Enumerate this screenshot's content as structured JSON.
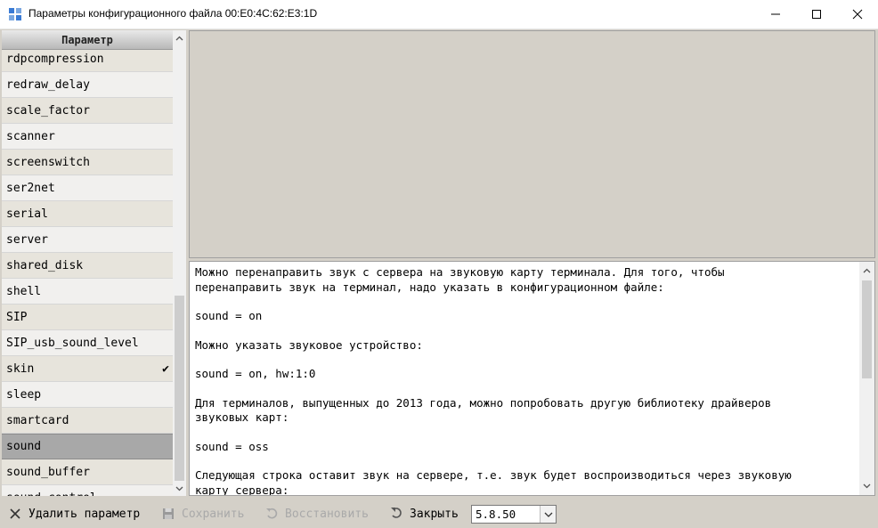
{
  "window": {
    "title": "Параметры конфигурационного файла 00:E0:4C:62:E3:1D"
  },
  "params": {
    "header": "Параметр",
    "items": [
      {
        "label": "rdpcompression",
        "checked": false,
        "selected": false
      },
      {
        "label": "redraw_delay",
        "checked": false,
        "selected": false
      },
      {
        "label": "scale_factor",
        "checked": false,
        "selected": false
      },
      {
        "label": "scanner",
        "checked": false,
        "selected": false
      },
      {
        "label": "screenswitch",
        "checked": false,
        "selected": false
      },
      {
        "label": "ser2net",
        "checked": false,
        "selected": false
      },
      {
        "label": "serial",
        "checked": false,
        "selected": false
      },
      {
        "label": "server",
        "checked": false,
        "selected": false
      },
      {
        "label": "shared_disk",
        "checked": false,
        "selected": false
      },
      {
        "label": "shell",
        "checked": false,
        "selected": false
      },
      {
        "label": "SIP",
        "checked": false,
        "selected": false
      },
      {
        "label": "SIP_usb_sound_level",
        "checked": false,
        "selected": false
      },
      {
        "label": "skin",
        "checked": true,
        "selected": false
      },
      {
        "label": "sleep",
        "checked": false,
        "selected": false
      },
      {
        "label": "smartcard",
        "checked": false,
        "selected": false
      },
      {
        "label": "sound",
        "checked": false,
        "selected": true
      },
      {
        "label": "sound_buffer",
        "checked": false,
        "selected": false
      },
      {
        "label": "sound_control",
        "checked": false,
        "selected": false
      }
    ]
  },
  "help": {
    "paragraphs": [
      "Можно перенаправить звук с сервера на звуковую карту терминала. Для того, чтобы\nперенаправить звук на терминал, надо указать в конфигурационном файле:",
      "sound = on",
      "Можно указать звуковое устройство:",
      "sound = on, hw:1:0",
      "Для терминалов, выпущенных до 2013 года, можно попробовать другую библиотеку драйверов\nзвуковых карт:",
      "sound = oss",
      "Следующая строка оставит звук на сервере, т.е. звук будет воспроизводиться через звуковую\nкарту сервера:"
    ]
  },
  "toolbar": {
    "delete_label": "Удалить параметр",
    "save_label": "Сохранить",
    "restore_label": "Восстановить",
    "close_label": "Закрыть",
    "version_value": "5.8.50"
  }
}
